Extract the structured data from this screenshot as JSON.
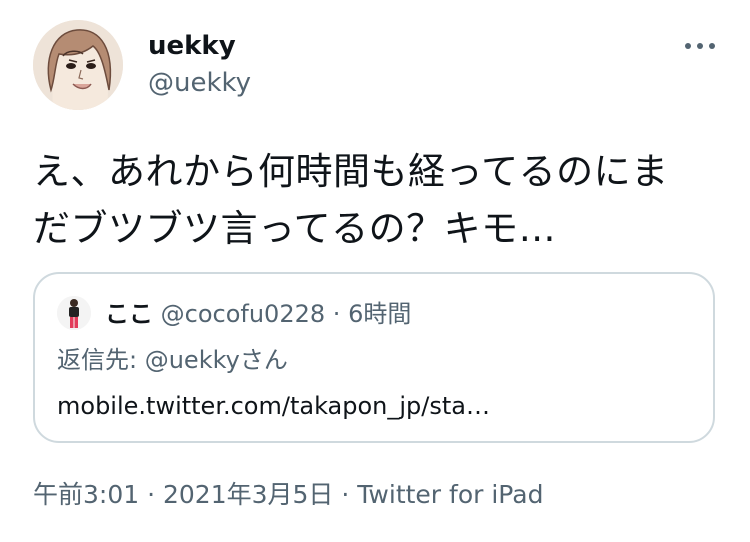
{
  "author": {
    "display_name": "uekky",
    "handle": "@uekky",
    "avatar_icon": "illustrated-woman-avatar"
  },
  "more_icon": "more-horizontal-icon",
  "tweet": {
    "line1": "え、あれから何時間も経ってるのにま",
    "line2": "だブツブツ言ってるの？キモ…"
  },
  "quote": {
    "avatar_icon": "person-photo-avatar",
    "name": "ここ",
    "handle": "@cocofu0228",
    "separator": "·",
    "time": "6時間",
    "reply_prefix": "返信先: ",
    "reply_mention": "@uekkyさん",
    "link": "mobile.twitter.com/takapon_jp/sta…"
  },
  "meta": {
    "time": "午前3:01",
    "separator": "·",
    "date": "2021年3月5日",
    "source": "Twitter for iPad"
  },
  "colors": {
    "text": "#0f1419",
    "secondary": "#536471",
    "border": "#cfd9de"
  }
}
